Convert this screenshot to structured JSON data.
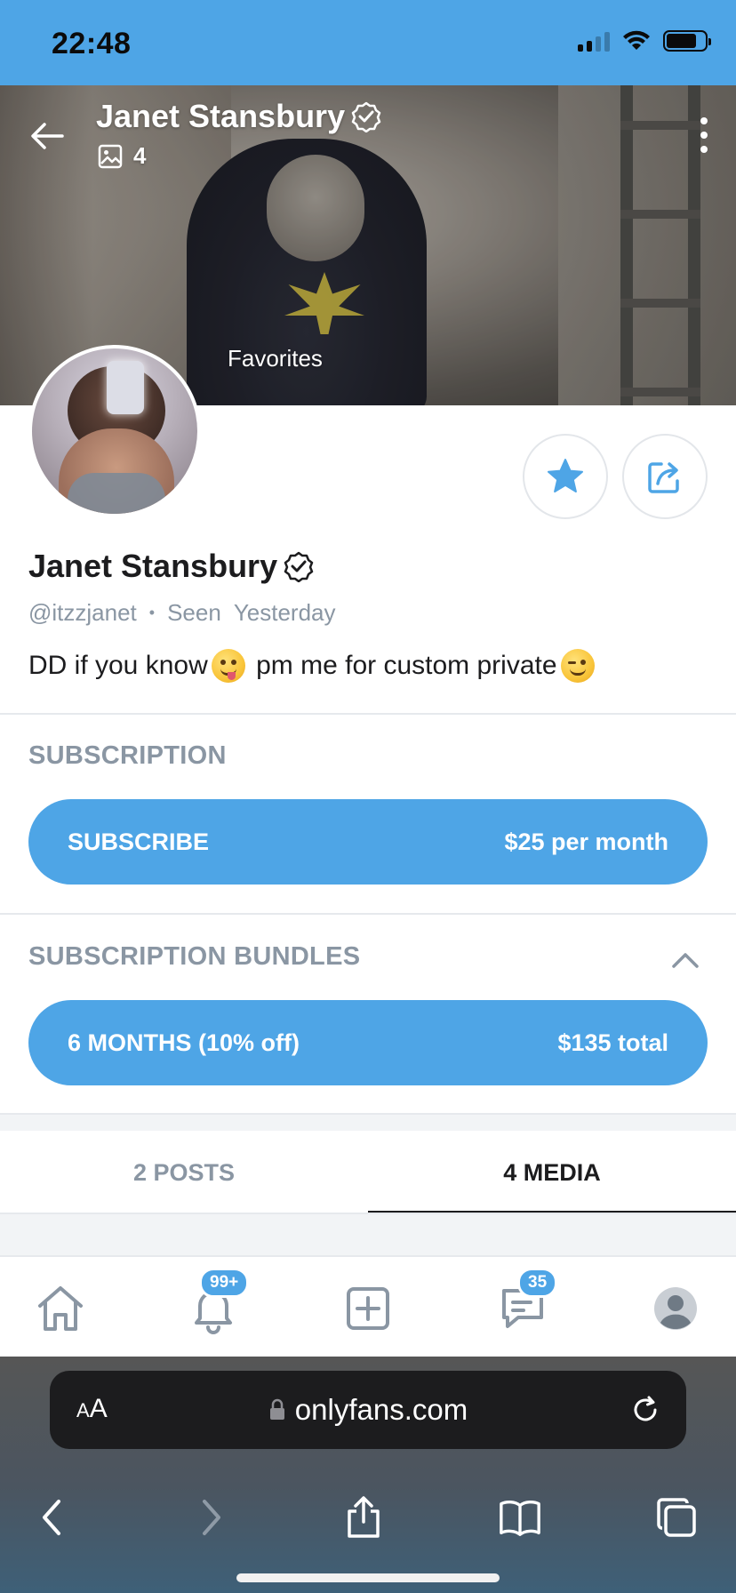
{
  "status_bar": {
    "time": "22:48"
  },
  "header": {
    "title": "Janet Stansbury",
    "media_count": "4",
    "cover_label": "Favorites"
  },
  "profile": {
    "name": "Janet Stansbury",
    "handle": "@itzzjanet",
    "seen_label": "Seen",
    "seen_value": "Yesterday",
    "bio_part1": "DD if you know",
    "bio_part2": " pm me for custom private"
  },
  "subscription": {
    "section_label": "SUBSCRIPTION",
    "button_label": "SUBSCRIBE",
    "price": "$25 per month"
  },
  "bundles": {
    "section_label": "SUBSCRIPTION BUNDLES",
    "items": [
      {
        "label": "6 MONTHS (10% off)",
        "price": "$135 total"
      }
    ]
  },
  "tabs": [
    {
      "label": "2 POSTS",
      "active": false
    },
    {
      "label": "4 MEDIA",
      "active": true
    }
  ],
  "bottom_nav": {
    "notifications_badge": "99+",
    "messages_badge": "35"
  },
  "browser": {
    "aa_label_small": "A",
    "aa_label_large": "A",
    "url": "onlyfans.com"
  },
  "colors": {
    "accent": "#4ea5e6",
    "muted_text": "#8a96a3"
  }
}
